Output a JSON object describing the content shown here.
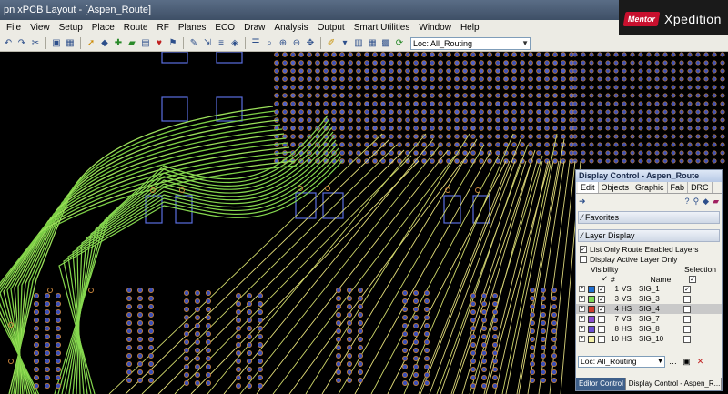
{
  "titlebar": {
    "title": "pn xPCB Layout  - [Aspen_Route]"
  },
  "brand": {
    "badge": "Mentor",
    "product": "Xpedition"
  },
  "menu": [
    "File",
    "View",
    "Setup",
    "Place",
    "Route",
    "RF",
    "Planes",
    "ECO",
    "Draw",
    "Analysis",
    "Output",
    "Smart Utilities",
    "Window",
    "Help"
  ],
  "toolbar": {
    "loc_value": "Loc: All_Routing"
  },
  "panel": {
    "title": "Display Control - Aspen_Route",
    "tabs": [
      "Edit",
      "Objects",
      "Graphic",
      "Fab",
      "DRC"
    ],
    "favorites": "Favorites",
    "layer_display": "Layer Display",
    "opt1": "List Only Route Enabled Layers",
    "opt2": "Display Active Layer Only",
    "col_visibility": "Visibility",
    "col_selection": "Selection",
    "col_num": "#",
    "col_name": "Name",
    "layers": [
      {
        "num": "1",
        "type": "VS",
        "name": "SIG_1",
        "color": "#1f6fd1",
        "visible": "✓",
        "sel": "✓"
      },
      {
        "num": "3",
        "type": "VS",
        "name": "SIG_3",
        "color": "#7ed957",
        "visible": "✓",
        "sel": ""
      },
      {
        "num": "4",
        "type": "HS",
        "name": "SIG_4",
        "color": "#d13a2a",
        "visible": "✓",
        "sel": ""
      },
      {
        "num": "7",
        "type": "VS",
        "name": "SIG_7",
        "color": "#8b4fd1",
        "visible": "",
        "sel": ""
      },
      {
        "num": "8",
        "type": "HS",
        "name": "SIG_8",
        "color": "#6a4fd1",
        "visible": "",
        "sel": ""
      },
      {
        "num": "10",
        "type": "HS",
        "name": "SIG_10",
        "color": "#f4f1a8",
        "visible": "",
        "sel": ""
      }
    ],
    "loc_value": "Loc: All_Routing",
    "bottom_tabs": [
      "Editor Control",
      "Display Control - Aspen_R..."
    ]
  }
}
